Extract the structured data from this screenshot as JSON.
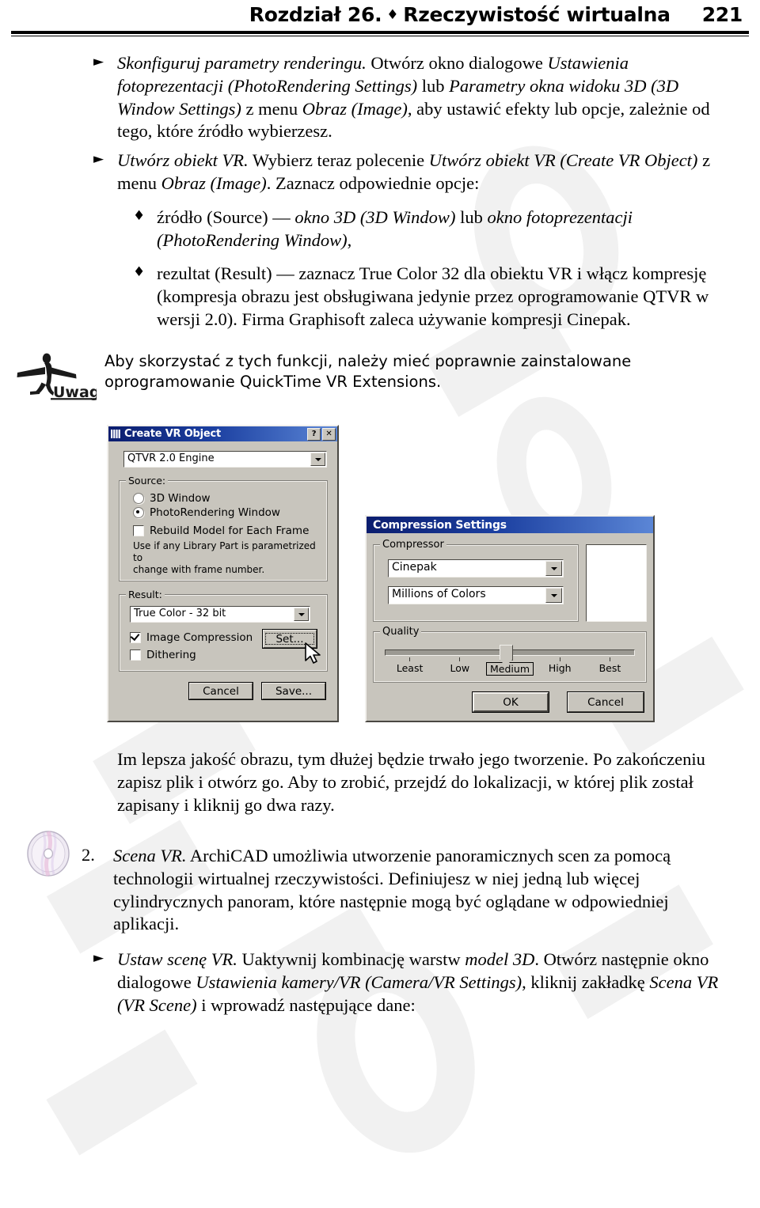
{
  "header": {
    "chapter": "Rozdział 26.",
    "diamond": "♦",
    "title": "Rzeczywistość wirtualna",
    "page_number": "221"
  },
  "bullets": {
    "triangle": "►",
    "diamond": "♦"
  },
  "body": {
    "item1": {
      "lead": "Skonfiguruj parametry renderingu.",
      "rest_1": " Otwórz okno dialogowe ",
      "it_1": "Ustawienia fotoprezentacji (PhotoRendering Settings)",
      "rest_2": " lub ",
      "it_2": "Parametry okna widoku 3D (3D Window Settings)",
      "rest_3": " z menu ",
      "it_3": "Obraz (Image)",
      "rest_4": ", aby ustawić efekty lub opcje, zależnie od tego, które źródło wybierzesz."
    },
    "item2": {
      "lead": "Utwórz obiekt VR.",
      "rest_1": " Wybierz teraz polecenie ",
      "it_1": "Utwórz obiekt VR (Create VR Object)",
      "rest_2": " z menu ",
      "it_2": "Obraz (Image)",
      "rest_3": ". Zaznacz odpowiednie opcje:"
    },
    "sub1": {
      "rest_1": "źródło (Source) — ",
      "it_1": "okno 3D (3D Window)",
      "rest_2": " lub ",
      "it_2": "okno fotoprezentacji (PhotoRendering Window)",
      "rest_3": ","
    },
    "sub2": {
      "text": "rezultat (Result) — zaznacz True Color 32 dla obiektu VR i włącz kompresję (kompresja obrazu jest obsługiwana jedynie przez oprogramowanie QTVR w wersji 2.0). Firma Graphisoft zaleca używanie kompresji Cinepak."
    },
    "note": {
      "icon_label": "Uwaga",
      "text": "Aby skorzystać z tych funkcji, należy mieć poprawnie zainstalowane oprogramowanie QuickTime VR Extensions."
    },
    "after_dialogs": "Im lepsza jakość obrazu, tym dłużej będzie trwało jego tworzenie. Po zakończeniu zapisz plik i otwórz go. Aby to zrobić, przejdź do lokalizacji, w której plik został zapisany i kliknij go dwa razy.",
    "item_numbered": {
      "number": "2.",
      "lead": "Scena VR.",
      "rest": " ArchiCAD umożliwia utworzenie panoramicznych scen za pomocą technologii wirtualnej rzeczywistości. Definiujesz w niej jedną lub więcej cylindrycznych panoram, które następnie mogą być oglądane w odpowiedniej aplikacji."
    },
    "item3": {
      "lead": "Ustaw scenę VR.",
      "rest_1": " Uaktywnij kombinację warstw ",
      "it_1": "model 3D",
      "rest_2": ". Otwórz następnie okno dialogowe ",
      "it_2": "Ustawienia kamery/VR (Camera/VR Settings)",
      "rest_3": ", kliknij zakładkę ",
      "it_3": "Scena VR (VR Scene)",
      "rest_4": " i wprowadź następujące dane:"
    }
  },
  "dialog_create_vr": {
    "title": "Create VR Object",
    "help_button": "?",
    "close_button": "✕",
    "engine_combo": "QTVR 2.0 Engine",
    "source_group": "Source:",
    "radio_3d_window": "3D Window",
    "radio_photorendering": "PhotoRendering Window",
    "radio_selected": "PhotoRendering Window",
    "checkbox_rebuild": "Rebuild Model for Each Frame",
    "checkbox_rebuild_checked": false,
    "hint_line1": "Use if any Library Part is parametrized to",
    "hint_line2": "change with frame number.",
    "result_group": "Result:",
    "result_combo": "True Color - 32 bit",
    "checkbox_image_compression": "Image Compression",
    "checkbox_image_compression_checked": true,
    "checkbox_dithering": "Dithering",
    "checkbox_dithering_checked": false,
    "button_set": "Set...",
    "button_cancel": "Cancel",
    "button_save": "Save..."
  },
  "dialog_compression": {
    "title": "Compression Settings",
    "compressor_group": "Compressor",
    "compressor_combo": "Cinepak",
    "depth_combo": "Millions of Colors",
    "quality_group": "Quality",
    "quality_ticks": [
      "Least",
      "Low",
      "Medium",
      "High",
      "Best"
    ],
    "quality_selected": "Medium",
    "button_ok": "OK",
    "button_cancel": "Cancel"
  },
  "colors": {
    "title_bar_dark": "#0b1d6e",
    "title_bar_light": "#5b86d6",
    "dialog_face": "#c8c5bd",
    "page_background": "#ffffff",
    "text": "#000000"
  }
}
